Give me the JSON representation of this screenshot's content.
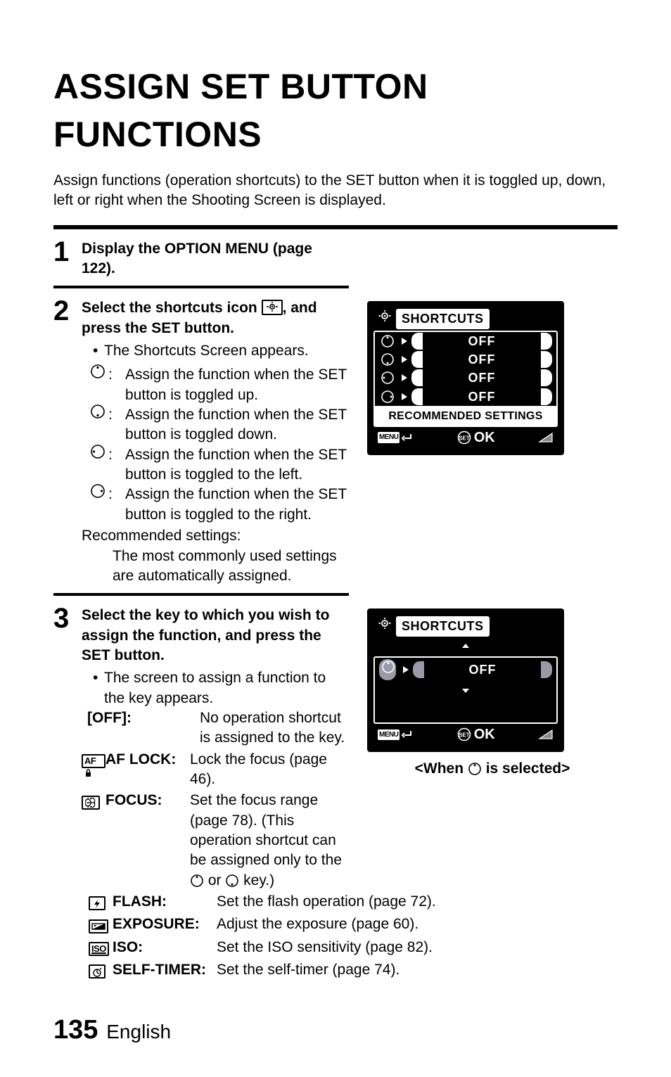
{
  "title": "ASSIGN SET BUTTON FUNCTIONS",
  "intro": "Assign functions (operation shortcuts) to the SET button when it is toggled up, down, left or right when the Shooting Screen is displayed.",
  "step1": {
    "num": "1",
    "head": "Display the OPTION MENU (page 122)."
  },
  "step2": {
    "num": "2",
    "head_a": "Select the shortcuts icon ",
    "head_b": ", and press the SET button.",
    "bullet1": "The Shortcuts Screen appears.",
    "dir_up_label": ":",
    "dir_up_text": "Assign the function when the SET button is toggled up.",
    "dir_down_text": "Assign the function when the SET button is toggled down.",
    "dir_left_text": "Assign the function when the SET button is toggled to the left.",
    "dir_right_text": "Assign the function when the SET button is toggled to the right.",
    "rec_label": "Recommended settings:",
    "rec_text": "The most commonly used settings are automatically assigned."
  },
  "step3": {
    "num": "3",
    "head": "Select the key to which you wish to assign the function, and press the SET button.",
    "bullet1": "The screen to assign a function to the key appears.",
    "off_label": "[OFF]:",
    "off_text": "No operation shortcut is assigned to the key.",
    "aflock_label": "AF LOCK:",
    "aflock_text": "Lock the focus (page 46).",
    "focus_label": "FOCUS:",
    "focus_text_a": "Set the focus range (page 78). (This operation shortcut can be assigned only to the ",
    "focus_text_b": " or ",
    "focus_text_c": " key.)",
    "flash_label": "FLASH:",
    "flash_text": "Set the flash operation (page 72).",
    "exposure_label": "EXPOSURE:",
    "exposure_text": "Adjust the exposure (page 60).",
    "iso_label": "ISO:",
    "iso_text": "Set the ISO sensitivity (page 82).",
    "selftimer_label": "SELF-TIMER:",
    "selftimer_text": "Set the self-timer (page 74)."
  },
  "lcd1": {
    "title": "SHORTCUTS",
    "row_value": "OFF",
    "rec": "RECOMMENDED SETTINGS",
    "menu": "MENU",
    "ok": "OK"
  },
  "lcd2": {
    "title": "SHORTCUTS",
    "value": "OFF",
    "menu": "MENU",
    "ok": "OK",
    "caption_a": "<When ",
    "caption_b": " is selected>"
  },
  "footer": {
    "page": "135",
    "lang": "English"
  },
  "icons": {
    "minibox_af": "AF",
    "minibox_iso": "ISO"
  }
}
